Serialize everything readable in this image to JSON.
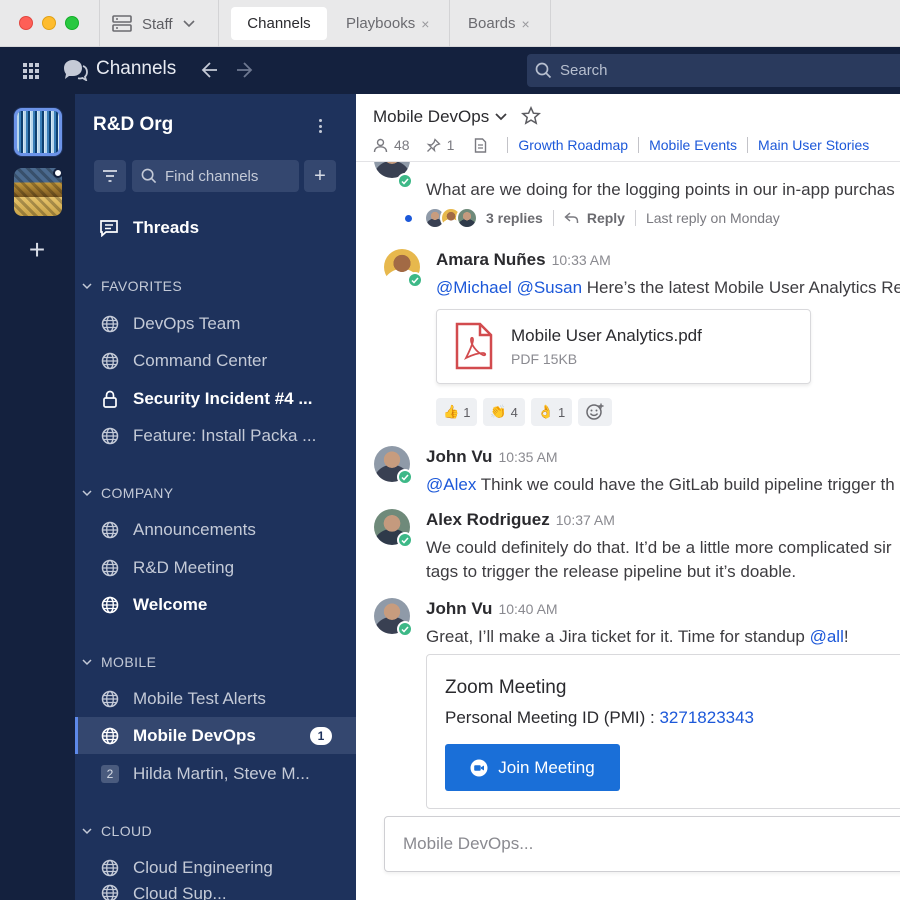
{
  "titlebar": {
    "server": "Staff",
    "tabs": [
      {
        "label": "Channels",
        "active": true
      },
      {
        "label": "Playbooks",
        "closable": true
      },
      {
        "label": "Boards",
        "closable": true
      }
    ],
    "close_glyph": "×"
  },
  "header": {
    "product": "Channels",
    "search_placeholder": "Search"
  },
  "team_sidebar": {
    "add_glyph": "+"
  },
  "sidebar": {
    "team_name": "R&D Org",
    "find_placeholder": "Find channels",
    "add_glyph": "+",
    "threads_label": "Threads",
    "categories": [
      {
        "label": "FAVORITES"
      },
      {
        "label": "COMPANY"
      },
      {
        "label": "MOBILE"
      },
      {
        "label": "CLOUD"
      }
    ],
    "channels": {
      "devops_team": "DevOps Team",
      "command_center": "Command Center",
      "security_incident": "Security Incident #4 ...",
      "feature_install": "Feature: Install Packa ...",
      "announcements": "Announcements",
      "rd_meeting": "R&D Meeting",
      "welcome": "Welcome",
      "mobile_test_alerts": "Mobile Test Alerts",
      "mobile_devops": "Mobile DevOps",
      "mobile_devops_badge": "1",
      "group_dm_count": "2",
      "group_dm": "Hilda Martin, Steve M...",
      "cloud_engineering": "Cloud Engineering",
      "cloud_partial": "Cloud Sup..."
    }
  },
  "channel": {
    "title": "Mobile DevOps",
    "member_count": "48",
    "pinned_count": "1",
    "links": [
      "Growth Roadmap",
      "Mobile Events",
      "Main User Stories"
    ]
  },
  "messages": {
    "top_text": "What are we doing for the logging points in our in-app purchas",
    "thread_replies": "3 replies",
    "thread_reply_label": "Reply",
    "thread_last_reply": "Last reply on Monday",
    "m1": {
      "sender": "Amara Nuñes",
      "time": "10:33 AM",
      "mention_1": "@Michael",
      "mention_2": "@Susan",
      "text": " Here’s the latest Mobile User Analytics Rep",
      "file_name": "Mobile User Analytics.pdf",
      "file_meta": "PDF 15KB",
      "reactions": [
        {
          "emoji": "👍",
          "count": "1"
        },
        {
          "emoji": "👏",
          "count": "4"
        },
        {
          "emoji": "👌",
          "count": "1"
        }
      ]
    },
    "m2": {
      "sender": "John Vu",
      "time": "10:35 AM",
      "mention": "@Alex",
      "text": " Think we could have the GitLab build pipeline trigger th"
    },
    "m3": {
      "sender": "Alex Rodriguez",
      "time": "10:37 AM",
      "line1": "We could definitely do that. It’d be a little more complicated sir",
      "line2": "tags to trigger the release pipeline but it’s doable."
    },
    "m4": {
      "sender": "John Vu",
      "time": "10:40 AM",
      "text": "Great, I’ll make a Jira ticket for it. Time for standup ",
      "mention": "@all",
      "suffix": "!",
      "zoom_title": "Zoom Meeting",
      "zoom_pmi_label": "Personal Meeting ID (PMI) : ",
      "zoom_pmi": "3271823343",
      "zoom_button": "Join Meeting"
    }
  },
  "composer": {
    "placeholder": "Mobile DevOps..."
  }
}
